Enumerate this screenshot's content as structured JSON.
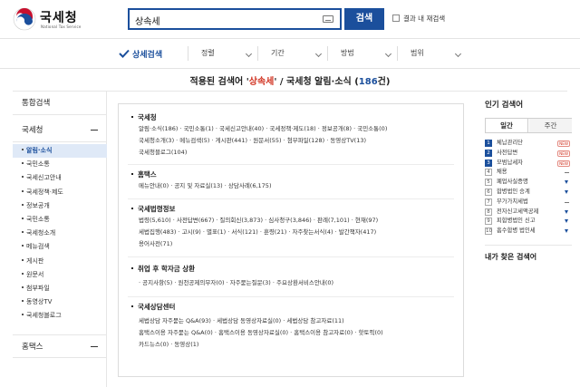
{
  "header": {
    "logo_title": "국세청",
    "logo_sub": "National Tax Service",
    "search_value": "상속세",
    "search_button": "검색",
    "re_search_label": "결과 내 재검색"
  },
  "filter": {
    "title": "상세검색",
    "items": [
      "정렬",
      "기간",
      "방법",
      "범위"
    ]
  },
  "summary": {
    "prefix": "적용된 검색어 '",
    "keyword": "상속세",
    "middle": "' / 국세청 알림·소식 (",
    "count": "186",
    "suffix": "건)"
  },
  "leftnav": {
    "all_label": "통합검색",
    "group1": "국세청",
    "items": [
      "알림·소식",
      "국민소통",
      "국세신고안내",
      "국세정책·제도",
      "정보공개",
      "국민소통",
      "국세청소개",
      "메뉴검색",
      "게시판",
      "원문서",
      "첨부파일",
      "동영상TV",
      "국세청블로그"
    ],
    "group2": "홈택스"
  },
  "sections": [
    {
      "title": "국세청",
      "lines": [
        "알림·소식(186)  ·  국민소통(1)  ·  국세신고안내(40)  ·  국세정책·제도(18)  ·  정보공개(8)  ·  국민소통(0)",
        "국세청소개(3)  ·  메뉴검색(5)  ·  게시판(441)  ·  원문서(55)  ·  첨부파일(128)  ·  동영상TV(13)",
        "국세청블로그(104)"
      ]
    },
    {
      "title": "홈택스",
      "lines": [
        "메뉴안내(0)  ·  공지 및 자료실(13)  ·  상담사례(6,175)"
      ]
    },
    {
      "title": "국세법령정보",
      "lines": [
        "법령(5,610)  ·  사전답변(667)  ·  질의회신(3,873)  ·  심사청구(3,846)  ·  판례(7,101)  ·  현재(97)",
        "세법집행(483)  ·  고시(9)  ·  별표(1)  ·  서식(121)  ·  훈령(21)  ·  자주찾는서식(4)  ·  발간책자(417)",
        "용어사전(71)"
      ]
    },
    {
      "title": "취업 후 학자금 상환",
      "lines": [
        "·  공지사항(5)  ·  원천공제의무자(0)  ·  자주묻는질문(3)  ·  주요상환서비스안내(0)"
      ]
    },
    {
      "title": "국세상담센터",
      "lines": [
        "세법상담 자주묻는 Q&A(93)  ·  세법상담 동영상자료실(0)  ·  세법상담 참고자료(11)",
        "홈택스이용 자주묻는 Q&A(0)  ·  홈택스이용 동영상자료실(0)  ·  홈택스이용 참고자료(0)  ·  핫토픽(0)",
        "카드뉴스(0)  ·  동영상(1)"
      ]
    }
  ],
  "popular": {
    "title": "인기 검색어",
    "tabs": [
      "일간",
      "주간"
    ],
    "items": [
      {
        "rank": "1",
        "label": "체납관리단",
        "trend": "NEW"
      },
      {
        "rank": "2",
        "label": "사전답변",
        "trend": "NEW"
      },
      {
        "rank": "3",
        "label": "모범납세자",
        "trend": "NEW"
      },
      {
        "rank": "4",
        "label": "채용",
        "trend": "same"
      },
      {
        "rank": "5",
        "label": "폐업사실증명",
        "trend": "down"
      },
      {
        "rank": "6",
        "label": "합병법인 승계",
        "trend": "down"
      },
      {
        "rank": "7",
        "label": "부가가치세법",
        "trend": "same"
      },
      {
        "rank": "8",
        "label": "전자신고세액공제",
        "trend": "down"
      },
      {
        "rank": "9",
        "label": "피합병법인 신고",
        "trend": "down"
      },
      {
        "rank": "10",
        "label": "흡수합병 법인세",
        "trend": "down"
      }
    ],
    "recent_title": "내가 찾은 검색어"
  },
  "colors": {
    "brand_blue": "#1b4f9c",
    "keyword_red": "#d0311f"
  }
}
